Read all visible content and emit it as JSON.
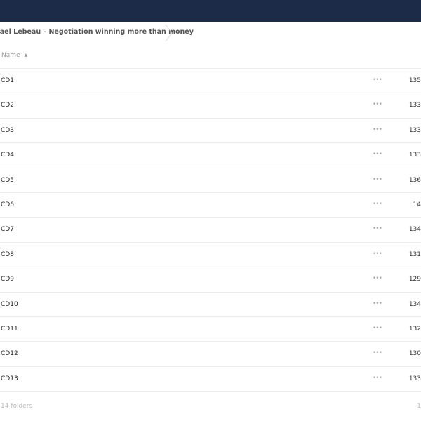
{
  "breadcrumb": {
    "current": "hael Lebeau – Negotiation winning more than money"
  },
  "list_header": {
    "name_label": "Name",
    "sort_indicator": "▲"
  },
  "files": [
    {
      "name": "CD1",
      "actions": "•••",
      "size": "135"
    },
    {
      "name": "CD2",
      "actions": "•••",
      "size": "133"
    },
    {
      "name": "CD3",
      "actions": "•••",
      "size": "133"
    },
    {
      "name": "CD4",
      "actions": "•••",
      "size": "133"
    },
    {
      "name": "CD5",
      "actions": "•••",
      "size": "136"
    },
    {
      "name": "CD6",
      "actions": "•••",
      "size": "14"
    },
    {
      "name": "CD7",
      "actions": "•••",
      "size": "134"
    },
    {
      "name": "CD8",
      "actions": "•••",
      "size": "131"
    },
    {
      "name": "CD9",
      "actions": "•••",
      "size": "129"
    },
    {
      "name": "CD10",
      "actions": "•••",
      "size": "134"
    },
    {
      "name": "CD11",
      "actions": "•••",
      "size": "132"
    },
    {
      "name": "CD12",
      "actions": "•••",
      "size": "130"
    },
    {
      "name": "CD13",
      "actions": "•••",
      "size": "133"
    }
  ],
  "footer": {
    "count": "14 folders",
    "total": "1"
  },
  "colors": {
    "topbar": "#1c2b48"
  }
}
